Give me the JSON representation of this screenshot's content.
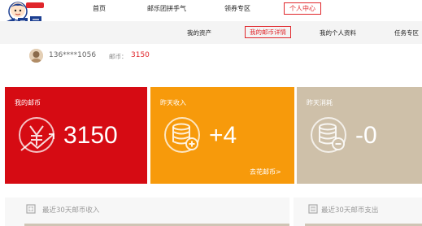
{
  "nav": {
    "items": [
      {
        "label": "首页"
      },
      {
        "label": "邮乐团拼手气"
      },
      {
        "label": "领券专区"
      },
      {
        "label": "个人中心"
      }
    ]
  },
  "subnav": {
    "items": [
      {
        "label": "我的资产"
      },
      {
        "label": "我的邮币详情"
      },
      {
        "label": "我的个人资料"
      },
      {
        "label": "任务专区"
      }
    ]
  },
  "user": {
    "phone": "136****1056",
    "coin_label": "邮币：",
    "coin_value": "3150"
  },
  "cards": [
    {
      "title": "我的邮币",
      "value": "3150",
      "color": "#d60b13",
      "icon": "yen-growth-icon"
    },
    {
      "title": "昨天收入",
      "value": "+4",
      "link": "去花邮币>",
      "color": "#f79a0b",
      "icon": "coin-stack-plus-icon"
    },
    {
      "title": "昨天消耗",
      "value": "-0",
      "color": "#cec0a9",
      "icon": "coin-stack-minus-icon"
    }
  ],
  "panels": {
    "income": "最近30天邮币收入",
    "expense": "最近30天邮币支出"
  },
  "colors": {
    "accent": "#e0262b"
  }
}
